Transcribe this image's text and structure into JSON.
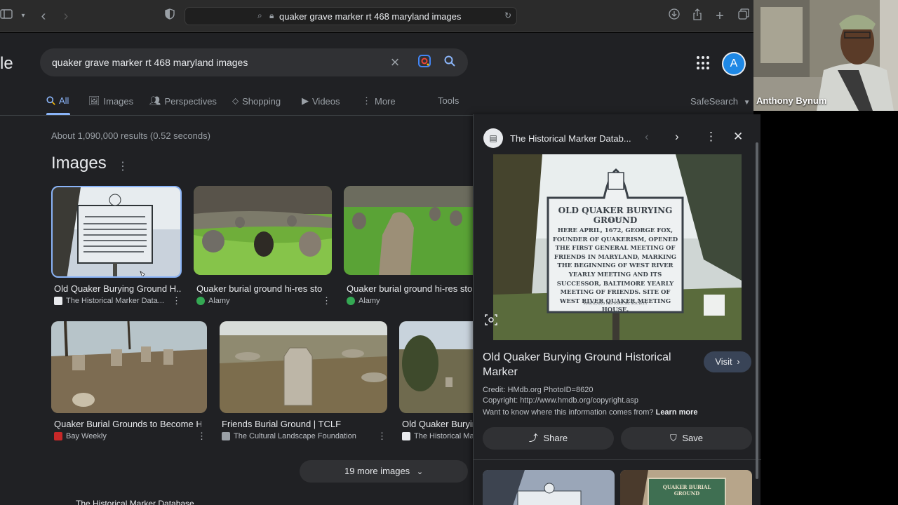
{
  "browser": {
    "url": "quaker grave marker rt 468 maryland images"
  },
  "google": {
    "logo_fragment": "le",
    "search_query": "quaker grave marker rt 468 maryland images",
    "avatar_letter": "A",
    "tabs": [
      {
        "label": "All",
        "icon": "search-icon"
      },
      {
        "label": "Images",
        "icon": "image-icon"
      },
      {
        "label": "Perspectives",
        "icon": "people-icon"
      },
      {
        "label": "Shopping",
        "icon": "tag-icon"
      },
      {
        "label": "Videos",
        "icon": "play-icon"
      },
      {
        "label": "More",
        "icon": "kebab-icon"
      }
    ],
    "tools_label": "Tools",
    "safesearch_label": "SafeSearch",
    "results_count": "About 1,090,000 results (0.52 seconds)",
    "images_heading": "Images",
    "image_results": [
      {
        "title": "Old Quaker Burying Ground H...",
        "source": "The Historical Marker Data..."
      },
      {
        "title": "Quaker burial ground hi-res sto...",
        "source": "Alamy"
      },
      {
        "title": "Quaker burial ground hi-res sto...",
        "source": "Alamy"
      },
      {
        "title": "Quaker Burial Grounds to Become Hi...",
        "source": "Bay Weekly"
      },
      {
        "title": "Friends Burial Ground | TCLF",
        "source": "The Cultural Landscape Foundation"
      },
      {
        "title": "Old Quaker Buryin",
        "source": "The Historical Ma"
      }
    ],
    "more_images_label": "19 more images",
    "bottom_fragment": "The Historical Marker Database"
  },
  "panel": {
    "source_name": "The Historical Marker Datab...",
    "marker_image": {
      "title": "OLD QUAKER BURYING GROUND",
      "year": "1672",
      "body": "HERE APRIL, 1672, GEORGE FOX, FOUNDER OF QUAKERISM, OPENED THE FIRST GENERAL MEETING OF FRIENDS IN MARYLAND, MARKING THE BEGINNING OF WEST RIVER YEARLY MEETING AND ITS SUCCESSOR, BALTIMORE YEARLY MEETING OF FRIENDS. SITE OF WEST RIVER QUAKER MEETING HOUSE.",
      "footer": "MARYLAND HISTORICAL SOCIETY"
    },
    "title": "Old Quaker Burying Ground Historical Marker",
    "visit_label": "Visit",
    "credit": "Credit: HMdb.org PhotoID=8620",
    "copyright": "Copyright: http://www.hmdb.org/copyright.asp",
    "learn_prefix": "Want to know where this information comes from?",
    "learn_link": "Learn more",
    "share_label": "Share",
    "save_label": "Save",
    "related_thumb_text": "QUAKER BURIAL GROUND"
  },
  "webcam": {
    "name": "Anthony Bynum"
  },
  "colors": {
    "accent": "#8ab4f8",
    "page_bg": "#202124",
    "surface": "#303134"
  }
}
